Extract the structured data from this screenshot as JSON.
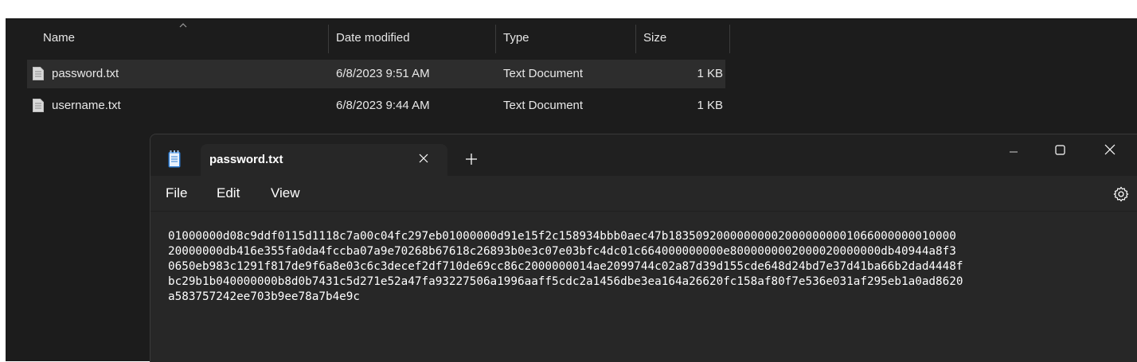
{
  "explorer": {
    "columns": {
      "name": "Name",
      "date_modified": "Date modified",
      "type": "Type",
      "size": "Size"
    },
    "files": [
      {
        "name": "password.txt",
        "date": "6/8/2023 9:51 AM",
        "type": "Text Document",
        "size": "1 KB",
        "selected": true
      },
      {
        "name": "username.txt",
        "date": "6/8/2023 9:44 AM",
        "type": "Text Document",
        "size": "1 KB",
        "selected": false
      }
    ]
  },
  "notepad": {
    "tab_title": "password.txt",
    "menu": {
      "file": "File",
      "edit": "Edit",
      "view": "View"
    },
    "content": "01000000d08c9ddf0115d1118c7a00c04fc297eb01000000d91e15f2c158934bbb0aec47b183509200000000020000000001066000000010000\n20000000db416e355fa0da4fccba07a9e70268b67618c26893b0e3c07e03bfc4dc01c664000000000e8000000002000020000000db40944a8f3\n0650eb983c1291f817de9f6a8e03c6c3decef2df710de69cc86c2000000014ae2099744c02a87d39d155cde648d24bd7e37d41ba66b2dad4448f\nbc29b1b040000000b8d0b7431c5d271e52a47fa93227506a1996aaff5cdc2a1456dbe3ea164a26620fc158af80f7e536e031af295eb1a0ad8620\na583757242ee703b9ee78a7b4e9c"
  },
  "icons": [
    "chevron-up-icon",
    "text-file-icon",
    "notepad-app-icon",
    "close-icon",
    "plus-icon",
    "minimize-icon",
    "maximize-icon",
    "gear-icon"
  ]
}
